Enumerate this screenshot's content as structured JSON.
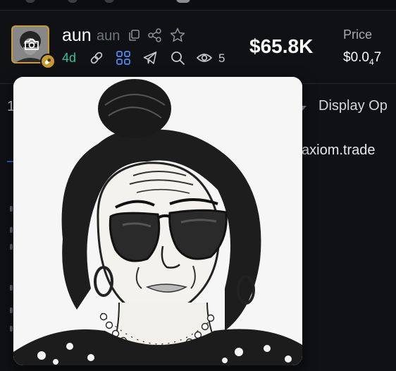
{
  "token": {
    "name": "aun",
    "ticker": "aun",
    "age": "4d",
    "viewers": "5"
  },
  "market": {
    "market_cap": "$65.8K",
    "price_label": "Price",
    "price_prefix": "$0.0",
    "price_zeros": "4",
    "price_suffix": "7"
  },
  "table": {
    "row_number": "1",
    "display_options": "Display Op"
  },
  "links": {
    "axiom": "axiom.trade"
  },
  "icons": {
    "copy": "copy-icon",
    "share": "share-icon",
    "star": "star-icon",
    "link": "link-icon",
    "community": "community-icon",
    "telegram": "telegram-icon",
    "search": "search-icon",
    "eye": "eye-icon",
    "camera": "camera-icon",
    "pill": "pill-icon"
  },
  "colors": {
    "background": "#101114",
    "accent_gold": "#c99a2e",
    "age_green": "#34c38f",
    "community_blue": "#4f8ff7",
    "muted": "#6f737d"
  }
}
